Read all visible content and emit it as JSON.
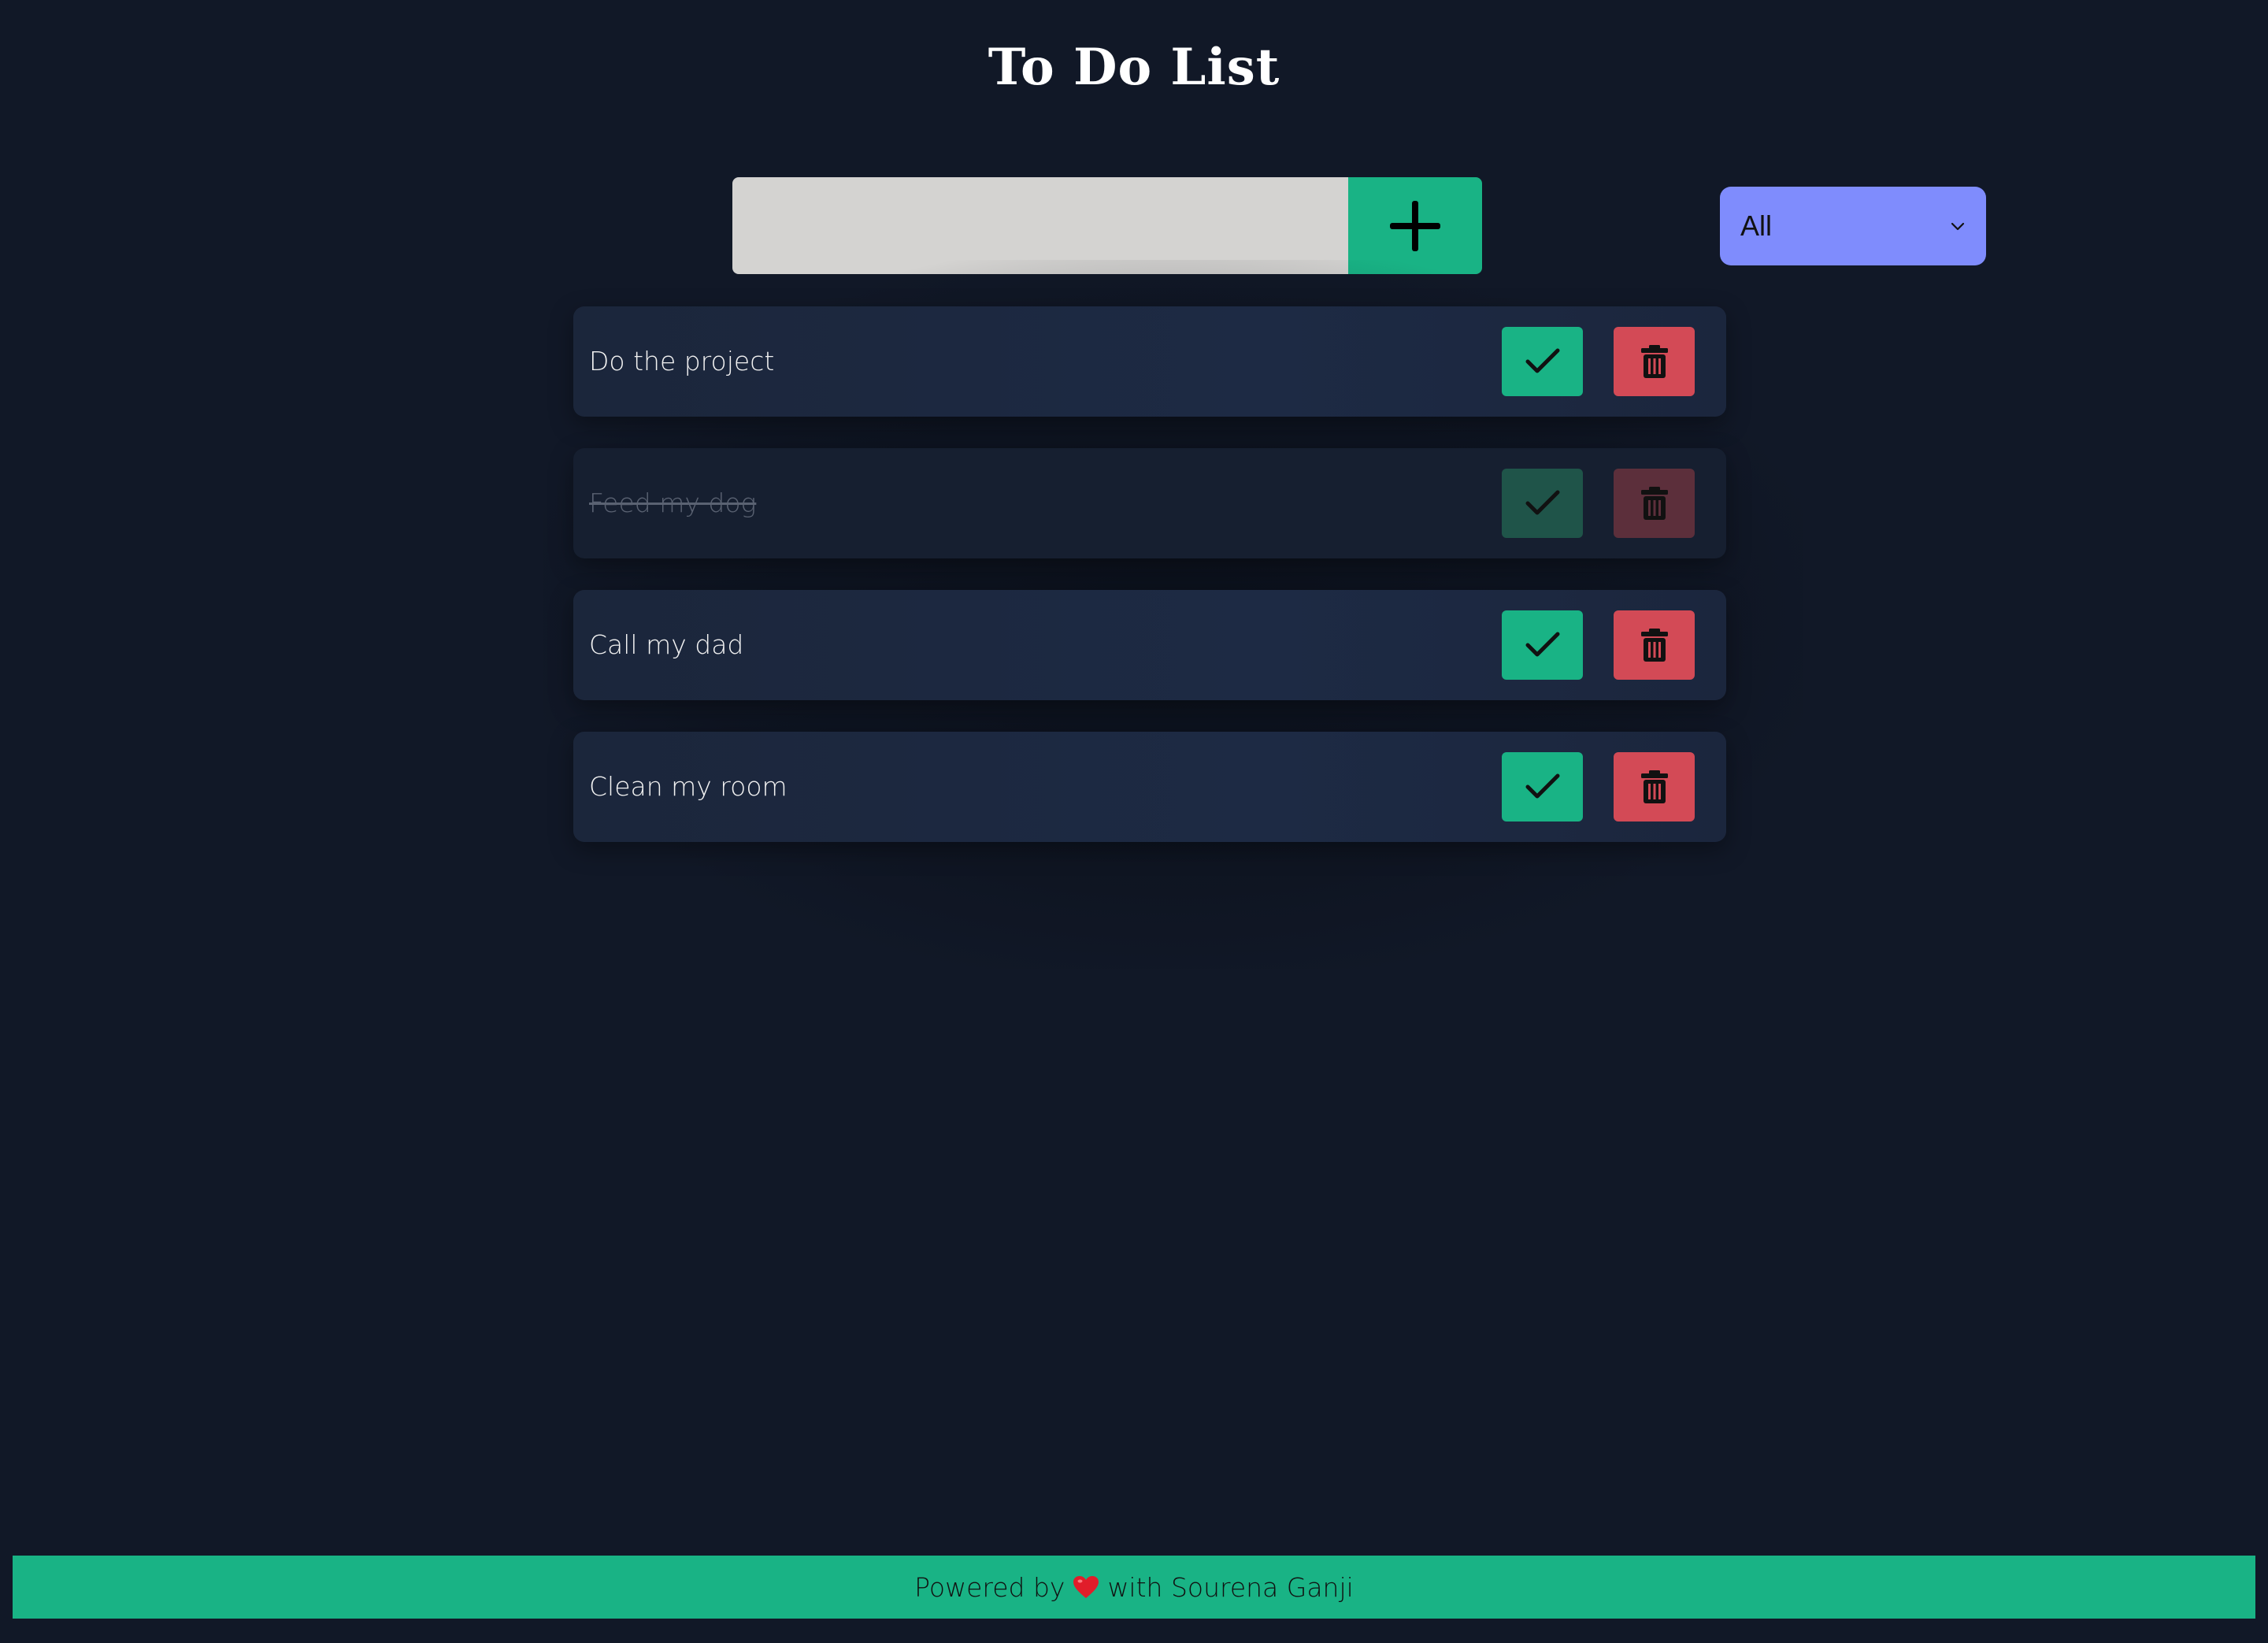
{
  "header": {
    "title": "To Do List"
  },
  "add_form": {
    "input_value": "",
    "add_icon": "plus-icon"
  },
  "filter": {
    "selected": "All",
    "icon": "chevron-down-icon"
  },
  "todos": [
    {
      "text": "Do the project",
      "completed": false
    },
    {
      "text": "Feed my dog",
      "completed": true
    },
    {
      "text": "Call my dad",
      "completed": false
    },
    {
      "text": "Clean my room",
      "completed": false
    }
  ],
  "actions": {
    "complete_icon": "check-icon",
    "delete_icon": "trash-icon"
  },
  "footer": {
    "prefix": "Powered by",
    "icon": "heart-icon",
    "suffix": "with Sourena Ganji"
  },
  "colors": {
    "background": "#111827",
    "accent_green": "#19b385",
    "danger_red": "#d34a56",
    "filter_bg": "#7f8cfd",
    "input_bg": "#d4d3d1"
  }
}
